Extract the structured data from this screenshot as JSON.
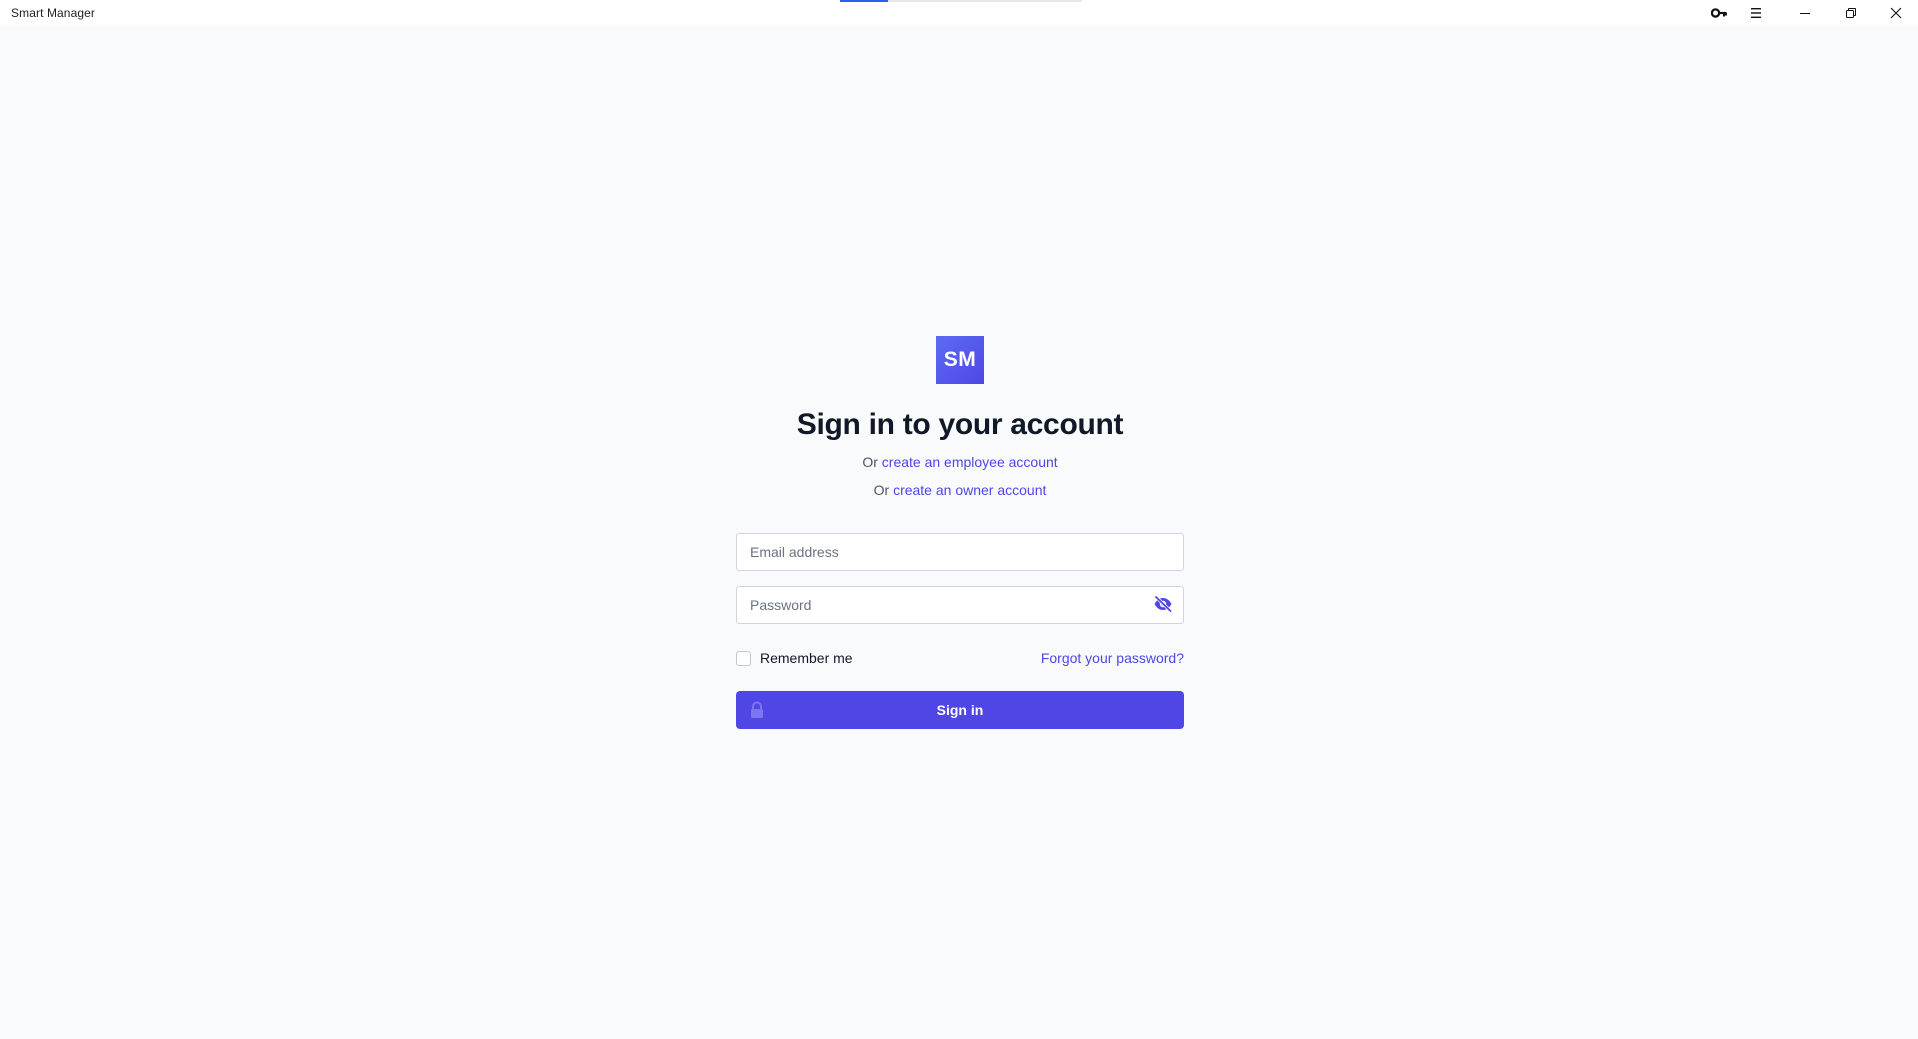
{
  "window": {
    "title": "Smart Manager",
    "loading_progress": 0.2
  },
  "titlebar_buttons": {
    "key_icon": "key-icon",
    "menu_icon": "hamburger-menu-icon",
    "minimize_icon": "minimize-icon",
    "restore_icon": "restore-icon",
    "close_icon": "close-icon"
  },
  "brand": {
    "logo_text": "SM",
    "logo_color": "#4f46e5"
  },
  "login": {
    "heading": "Sign in to your account",
    "employee_prefix": "Or",
    "employee_link": "create an employee account",
    "owner_prefix": "Or",
    "owner_link": "create an owner account",
    "email_placeholder": "Email address",
    "password_placeholder": "Password",
    "password_toggle_icon": "eye-slash-icon",
    "remember_label": "Remember me",
    "remember_checked": false,
    "forgot_link": "Forgot your password?",
    "submit_label": "Sign in",
    "submit_icon": "lock-icon"
  },
  "colors": {
    "accent": "#4f46e5",
    "background": "#f8fafc",
    "heading": "#111827"
  }
}
